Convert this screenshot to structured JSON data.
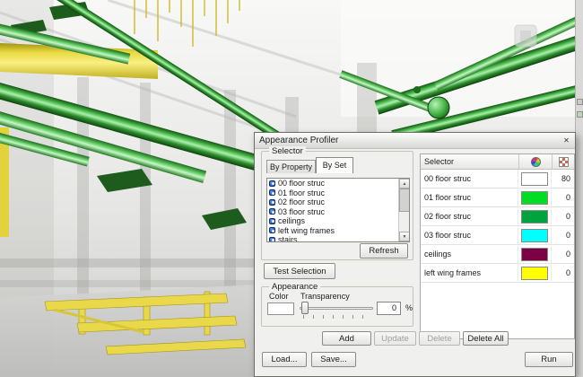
{
  "scene": {
    "pipe_green": "#3fae3f",
    "duct_yellow": "#e8d84a"
  },
  "dialog": {
    "title": "Appearance Profiler",
    "close_glyph": "✕",
    "selector_group": {
      "label": "Selector",
      "tabs": [
        {
          "label": "By Property"
        },
        {
          "label": "By Set"
        }
      ],
      "sets": [
        "00 floor struc",
        "01 floor struc",
        "02 floor struc",
        "03 floor struc",
        "ceilings",
        "left wing frames",
        "stairs"
      ],
      "refresh_label": "Refresh"
    },
    "test_selection_label": "Test Selection",
    "appearance_group": {
      "label": "Appearance",
      "color_label": "Color",
      "transparency_label": "Transparency",
      "color_value": "#ffffff",
      "transparency_value": "0",
      "percent_label": "%"
    },
    "profile_table": {
      "header": "Selector",
      "rows": [
        {
          "name": "00 floor struc",
          "color": "#ffffff",
          "transparency": "80"
        },
        {
          "name": "01 floor struc",
          "color": "#00dd22",
          "transparency": "0"
        },
        {
          "name": "02 floor struc",
          "color": "#00a33e",
          "transparency": "0"
        },
        {
          "name": "03 floor struc",
          "color": "#00ffff",
          "transparency": "0"
        },
        {
          "name": "ceilings",
          "color": "#7d0045",
          "transparency": "0"
        },
        {
          "name": "left wing frames",
          "color": "#ffff00",
          "transparency": "0"
        }
      ]
    },
    "buttons": {
      "add": "Add",
      "update": "Update",
      "delete": "Delete",
      "delete_all": "Delete All",
      "load": "Load...",
      "save": "Save...",
      "run": "Run"
    }
  }
}
